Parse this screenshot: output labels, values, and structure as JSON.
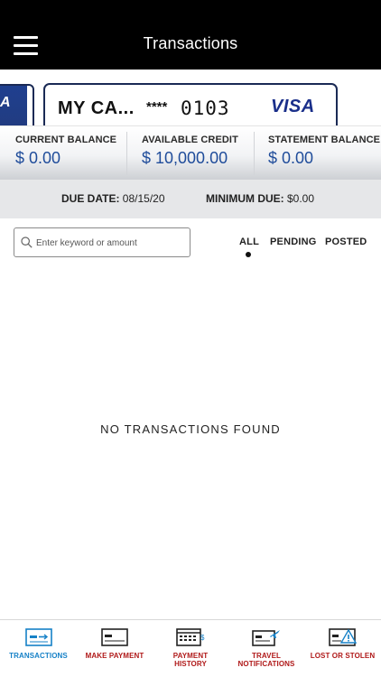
{
  "header": {
    "title": "Transactions"
  },
  "card": {
    "prev_letter": "A",
    "name": "MY CA...",
    "mask": "****",
    "last4": "0103",
    "brand": "VISA"
  },
  "balances": [
    {
      "label": "CURRENT BALANCE",
      "value": "$ 0.00"
    },
    {
      "label": "AVAILABLE CREDIT",
      "value": "$ 10,000.00"
    },
    {
      "label": "STATEMENT BALANCE",
      "value": "$ 0.00"
    }
  ],
  "due": {
    "due_date_label": "DUE DATE:",
    "due_date_value": "08/15/20",
    "min_due_label": "MINIMUM DUE:",
    "min_due_value": "$0.00"
  },
  "search": {
    "placeholder": "Enter keyword or amount",
    "value": ""
  },
  "filters": {
    "items": [
      {
        "label": "ALL"
      },
      {
        "label": "PENDING"
      },
      {
        "label": "POSTED"
      }
    ],
    "selected": "ALL"
  },
  "empty_message": "NO TRANSACTIONS FOUND",
  "tabbar": {
    "items": [
      {
        "label_line1": "TRANSACTIONS",
        "label_line2": "",
        "icon": "transactions-icon"
      },
      {
        "label_line1": "MAKE PAYMENT",
        "label_line2": "",
        "icon": "make-payment-icon"
      },
      {
        "label_line1": "PAYMENT",
        "label_line2": "HISTORY",
        "icon": "payment-history-icon"
      },
      {
        "label_line1": "TRAVEL",
        "label_line2": "NOTIFICATIONS",
        "icon": "travel-icon"
      },
      {
        "label_line1": "LOST OR STOLEN",
        "label_line2": "",
        "icon": "lost-stolen-icon"
      }
    ],
    "active": "TRANSACTIONS"
  },
  "colors": {
    "header_bg": "#000000",
    "balance_value": "#1f4c9a",
    "tab_active": "#1681c7",
    "tab_inactive": "#b01919",
    "visa_blue": "#1a2f8a"
  }
}
